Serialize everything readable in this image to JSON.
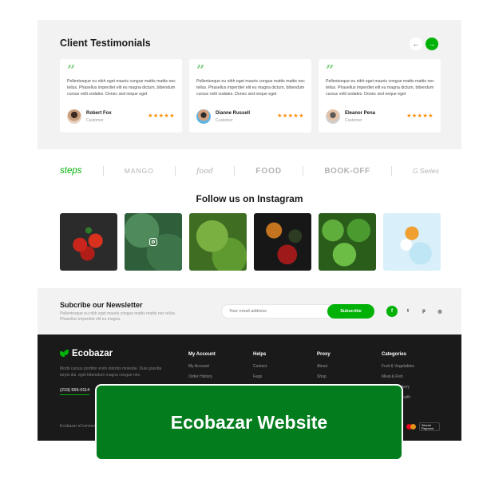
{
  "colors": {
    "accent": "#00b207",
    "banner": "#037c1e",
    "footer_bg": "#1a1a1a",
    "section_bg": "#f2f2f2",
    "star": "#ff8a00"
  },
  "testimonials": {
    "title": "Client Testimonials",
    "prev_icon": "arrow-left-icon",
    "next_icon": "arrow-right-icon",
    "prev_glyph": "←",
    "next_glyph": "→",
    "quote_glyph": "”",
    "items": [
      {
        "text": "Pellentesque eu nibh eget mauris congue mattis mattis nec tellus. Phasellus imperdiet elit eu magna dictum, bibendum cursus velit sodales. Donec sed neque eget",
        "name": "Robert Fox",
        "role": "Customer",
        "rating": 5,
        "stars": "★★★★★"
      },
      {
        "text": "Pellentesque eu nibh eget mauris congue mattis mattis nec tellus. Phasellus imperdiet elit eu magna dictum, bibendum cursus velit sodales. Donec sed neque eget",
        "name": "Dianne Russell",
        "role": "Customer",
        "rating": 5,
        "stars": "★★★★★"
      },
      {
        "text": "Pellentesque eu nibh eget mauris congue mattis mattis nec tellus. Phasellus imperdiet elit eu magna dictum, bibendum cursus velit sodales. Donec sed neque eget",
        "name": "Eleanor Pena",
        "role": "Customer",
        "rating": 5,
        "stars": "★★★★★"
      }
    ]
  },
  "brands": [
    "steps",
    "MANGO",
    "food",
    "FOOD",
    "BOOK-OFF",
    "G Series"
  ],
  "instagram": {
    "title": "Follow us on Instagram",
    "icon": "instagram-icon"
  },
  "newsletter": {
    "title": "Subcribe our Newsletter",
    "text": "Pellentesque eu nibh eget mauris congue mattis mattis nec tellus. Phasellus imperdiet elit eu magna.",
    "placeholder": "Your email address",
    "button": "Subscribe",
    "socials": [
      {
        "icon": "facebook-icon",
        "glyph": "f"
      },
      {
        "icon": "twitter-icon",
        "glyph": "t"
      },
      {
        "icon": "pinterest-icon",
        "glyph": "p"
      },
      {
        "icon": "instagram-icon",
        "glyph": "◎"
      }
    ]
  },
  "footer": {
    "logo": "Ecobazar",
    "description": "Morbi cursus porttitor enim lobortis molestie. Duis gravida turpis dui, eget bibendum magna congue nec.",
    "phone": "(219) 555-0114",
    "columns": [
      {
        "title": "My Account",
        "items": [
          "My Account",
          "Order History"
        ]
      },
      {
        "title": "Helps",
        "items": [
          "Contact",
          "Faqs"
        ]
      },
      {
        "title": "Proxy",
        "items": [
          "About",
          "Shop"
        ]
      },
      {
        "title": "Categories",
        "items": [
          "Fruit & Vegetables",
          "Meat & Fish",
          "Bread & Bakery",
          "Beauty & Health"
        ]
      }
    ],
    "copyright": "Ecobazar eCommerce © 2021. All Rights Reserved",
    "payment_secure": "Secure Payment"
  },
  "banner": {
    "title": "Ecobazar Website"
  }
}
